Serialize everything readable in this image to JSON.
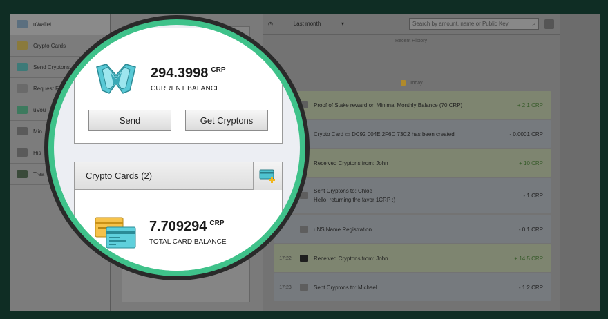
{
  "sidebar": {
    "items": [
      {
        "label": "uWallet",
        "icon": "wallet-icon"
      },
      {
        "label": "Crypto Cards",
        "icon": "cards-icon"
      },
      {
        "label": "Send Cryptons",
        "icon": "send-icon"
      },
      {
        "label": "Request F",
        "icon": "request-icon"
      },
      {
        "label": "uVou",
        "icon": "voucher-icon"
      },
      {
        "label": "Min",
        "icon": "mining-icon"
      },
      {
        "label": "His",
        "icon": "history-icon"
      },
      {
        "label": "Trea",
        "icon": "treasury-icon"
      }
    ]
  },
  "history": {
    "period": "Last month",
    "search_placeholder": "Search by amount, name or Public Key",
    "section_title": "Recent History",
    "day_label": "Today",
    "rows": [
      {
        "time": "",
        "desc": "Proof of Stake reward on Minimal Monthly Balance (70 CRP)",
        "sub": "",
        "amount": "+ 2.1 CRP",
        "kind": "plus"
      },
      {
        "time": "",
        "desc": "Crypto Card ▭ DC92 004E 2F6D 73C2 has been created",
        "sub": "",
        "amount": "- 0.0001 CRP",
        "kind": "minus"
      },
      {
        "time": "",
        "desc": "Received Cryptons from: John",
        "sub": "",
        "amount": "+ 10 CRP",
        "kind": "plus"
      },
      {
        "time": "",
        "desc": "Sent Cryptons to: Chloe",
        "sub": "Hello, returning the favor 1CRP :)",
        "amount": "- 1 CRP",
        "kind": "minus"
      },
      {
        "time": "",
        "desc": "uNS Name Registration",
        "sub": "",
        "amount": "- 0.1 CRP",
        "kind": "minus"
      },
      {
        "time": "17:22",
        "desc": "Received Cryptons from: John",
        "sub": "",
        "amount": "+ 14.5 CRP",
        "kind": "plus"
      },
      {
        "time": "17:23",
        "desc": "Sent Cryptons to: Michael",
        "sub": "",
        "amount": "- 1.2 CRP",
        "kind": "minus"
      }
    ]
  },
  "wallet": {
    "balance": "294.3998",
    "unit": "CRP",
    "balance_label": "CURRENT BALANCE",
    "send_label": "Send",
    "get_label": "Get Cryptons"
  },
  "cards": {
    "header": "Crypto Cards (2)",
    "balance": "7.709294",
    "unit": "CRP",
    "balance_label": "TOTAL CARD BALANCE"
  },
  "colors": {
    "lens_ring": "#3fc28a",
    "frame": "#0f2d24"
  }
}
